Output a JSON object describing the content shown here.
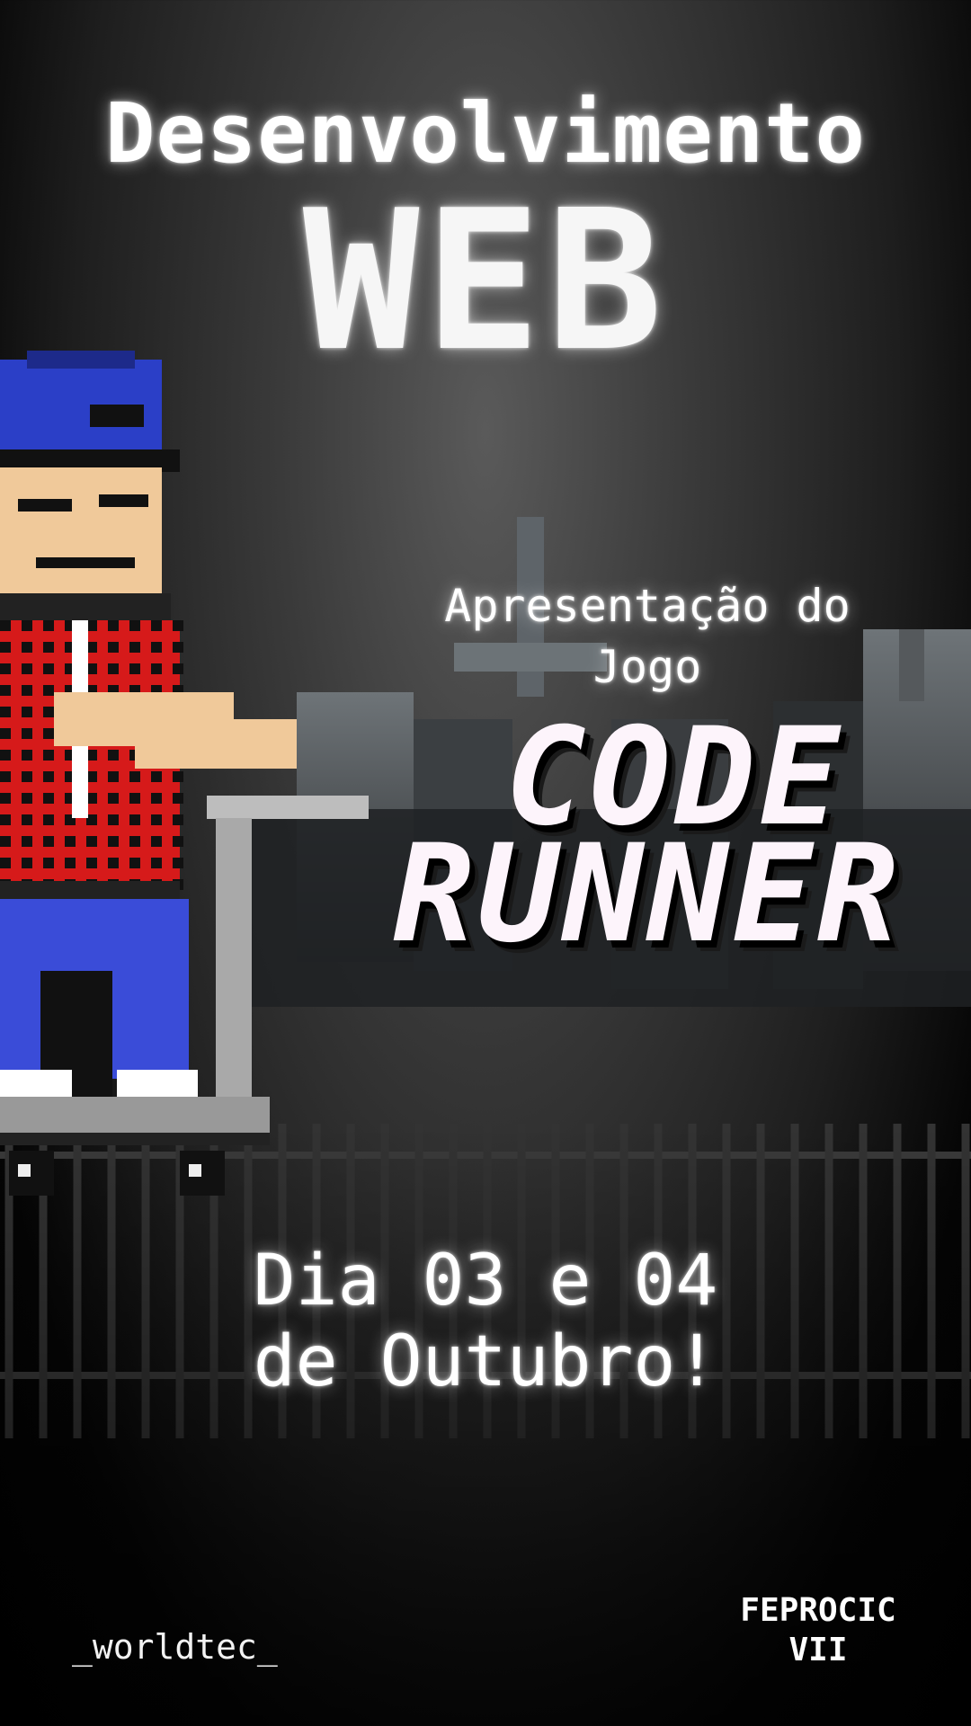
{
  "poster": {
    "title_line1": "Desenvolvimento",
    "title_line2": "WEB",
    "subtitle_line1": "Apresentação do",
    "subtitle_line2": "Jogo",
    "game_logo_line1": "CODE",
    "game_logo_line2": "RUNNER",
    "date_line1": "Dia 03 e 04",
    "date_line2": "de Outubro!",
    "handle": "_worldtec_",
    "event_line1": "FEPROCIC",
    "event_line2": "VII"
  },
  "icons": {
    "character": "pixel-boy-on-scooter",
    "background": "graveyard-tombstones",
    "fence": "iron-fence"
  },
  "colors": {
    "cap": "#2b3fc7",
    "shirt": "#d61a1a",
    "pants": "#3a4cd8",
    "skin": "#f0c99a"
  }
}
